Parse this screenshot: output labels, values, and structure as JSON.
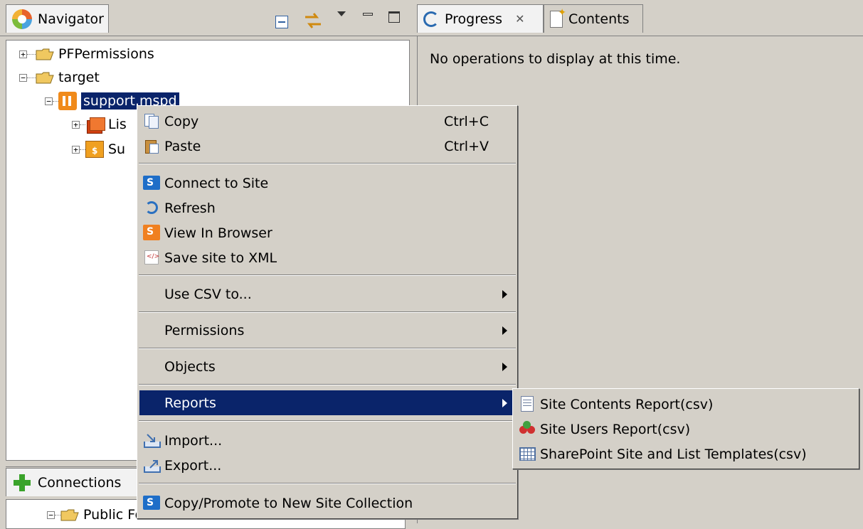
{
  "navigator": {
    "title": "Navigator",
    "tree": [
      {
        "label": "PFPermissions",
        "expander": "+"
      },
      {
        "label": "target",
        "expander": "−"
      },
      {
        "label": "support.mspd",
        "expander": "−"
      },
      {
        "label": "Lis",
        "expander": "+"
      },
      {
        "label": "Su",
        "expander": "+"
      }
    ]
  },
  "connections": {
    "title": "Connections",
    "tree_row": "Public Folders - Administrator"
  },
  "right_panel": {
    "tabs": [
      {
        "label": "Progress"
      },
      {
        "label": "Contents"
      }
    ],
    "message": "No operations to display at this time."
  },
  "context_menu": {
    "items": [
      {
        "label": "Copy",
        "shortcut": "Ctrl+C",
        "icon": "copy-icon"
      },
      {
        "label": "Paste",
        "shortcut": "Ctrl+V",
        "icon": "paste-icon"
      },
      {
        "label": "Connect to Site",
        "icon": "sharepoint-icon"
      },
      {
        "label": "Refresh",
        "icon": "refresh-icon"
      },
      {
        "label": "View In Browser",
        "icon": "browser-icon"
      },
      {
        "label": "Save site to XML",
        "icon": "xml-icon"
      },
      {
        "label": "Use CSV to..."
      },
      {
        "label": "Permissions"
      },
      {
        "label": "Objects"
      },
      {
        "label": "Reports"
      },
      {
        "label": "Import...",
        "icon": "import-icon"
      },
      {
        "label": "Export...",
        "icon": "export-icon"
      },
      {
        "label": "Copy/Promote to New Site Collection",
        "icon": "sharepoint-icon"
      }
    ]
  },
  "reports_submenu": {
    "items": [
      {
        "label": "Site Contents Report(csv)",
        "icon": "document-icon"
      },
      {
        "label": "Site Users Report(csv)",
        "icon": "users-icon"
      },
      {
        "label": "SharePoint Site and List Templates(csv)",
        "icon": "grid-icon"
      }
    ]
  },
  "colors": {
    "selection": "#0a246a",
    "chrome": "#d4d0c8",
    "folder": "#f0c860"
  }
}
